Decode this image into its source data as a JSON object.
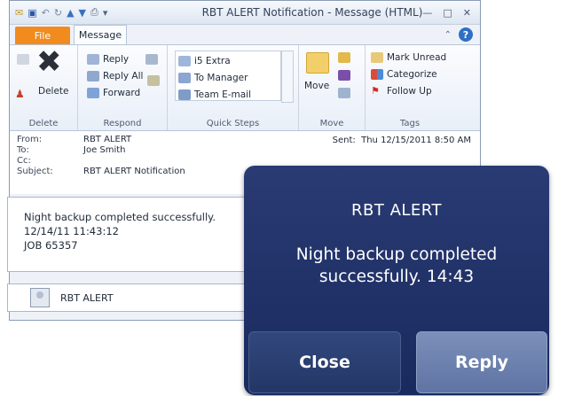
{
  "window": {
    "title": "RBT ALERT Notification - Message (HTML)",
    "tabs": {
      "file": "File",
      "message": "Message"
    },
    "help_glyph": "?"
  },
  "ribbon": {
    "delete_group": {
      "label": "Delete",
      "delete_button": "Delete"
    },
    "respond_group": {
      "label": "Respond",
      "reply": "Reply",
      "reply_all": "Reply All",
      "forward": "Forward"
    },
    "quick_steps_group": {
      "label": "Quick Steps",
      "items": [
        "i5 Extra",
        "To Manager",
        "Team E-mail"
      ]
    },
    "move_group": {
      "label": "Move",
      "move_button": "Move"
    },
    "tags_group": {
      "label": "Tags",
      "mark_unread": "Mark Unread",
      "categorize": "Categorize",
      "follow_up": "Follow Up"
    }
  },
  "headers": {
    "from_label": "From:",
    "from": "RBT ALERT",
    "to_label": "To:",
    "to": "Joe Smith",
    "cc_label": "Cc:",
    "cc": "",
    "subject_label": "Subject:",
    "subject": "RBT ALERT Notification",
    "sent_label": "Sent:",
    "sent": "Thu 12/15/2011 8:50 AM"
  },
  "body": {
    "line1": "Night backup completed successfully.",
    "line2": "12/14/11 11:43:12",
    "line3": "JOB 65357"
  },
  "people_pane": {
    "name": "RBT ALERT"
  },
  "popup": {
    "title": "RBT ALERT",
    "message": "Night backup completed successfully. 14:43",
    "close_label": "Close",
    "reply_label": "Reply"
  }
}
